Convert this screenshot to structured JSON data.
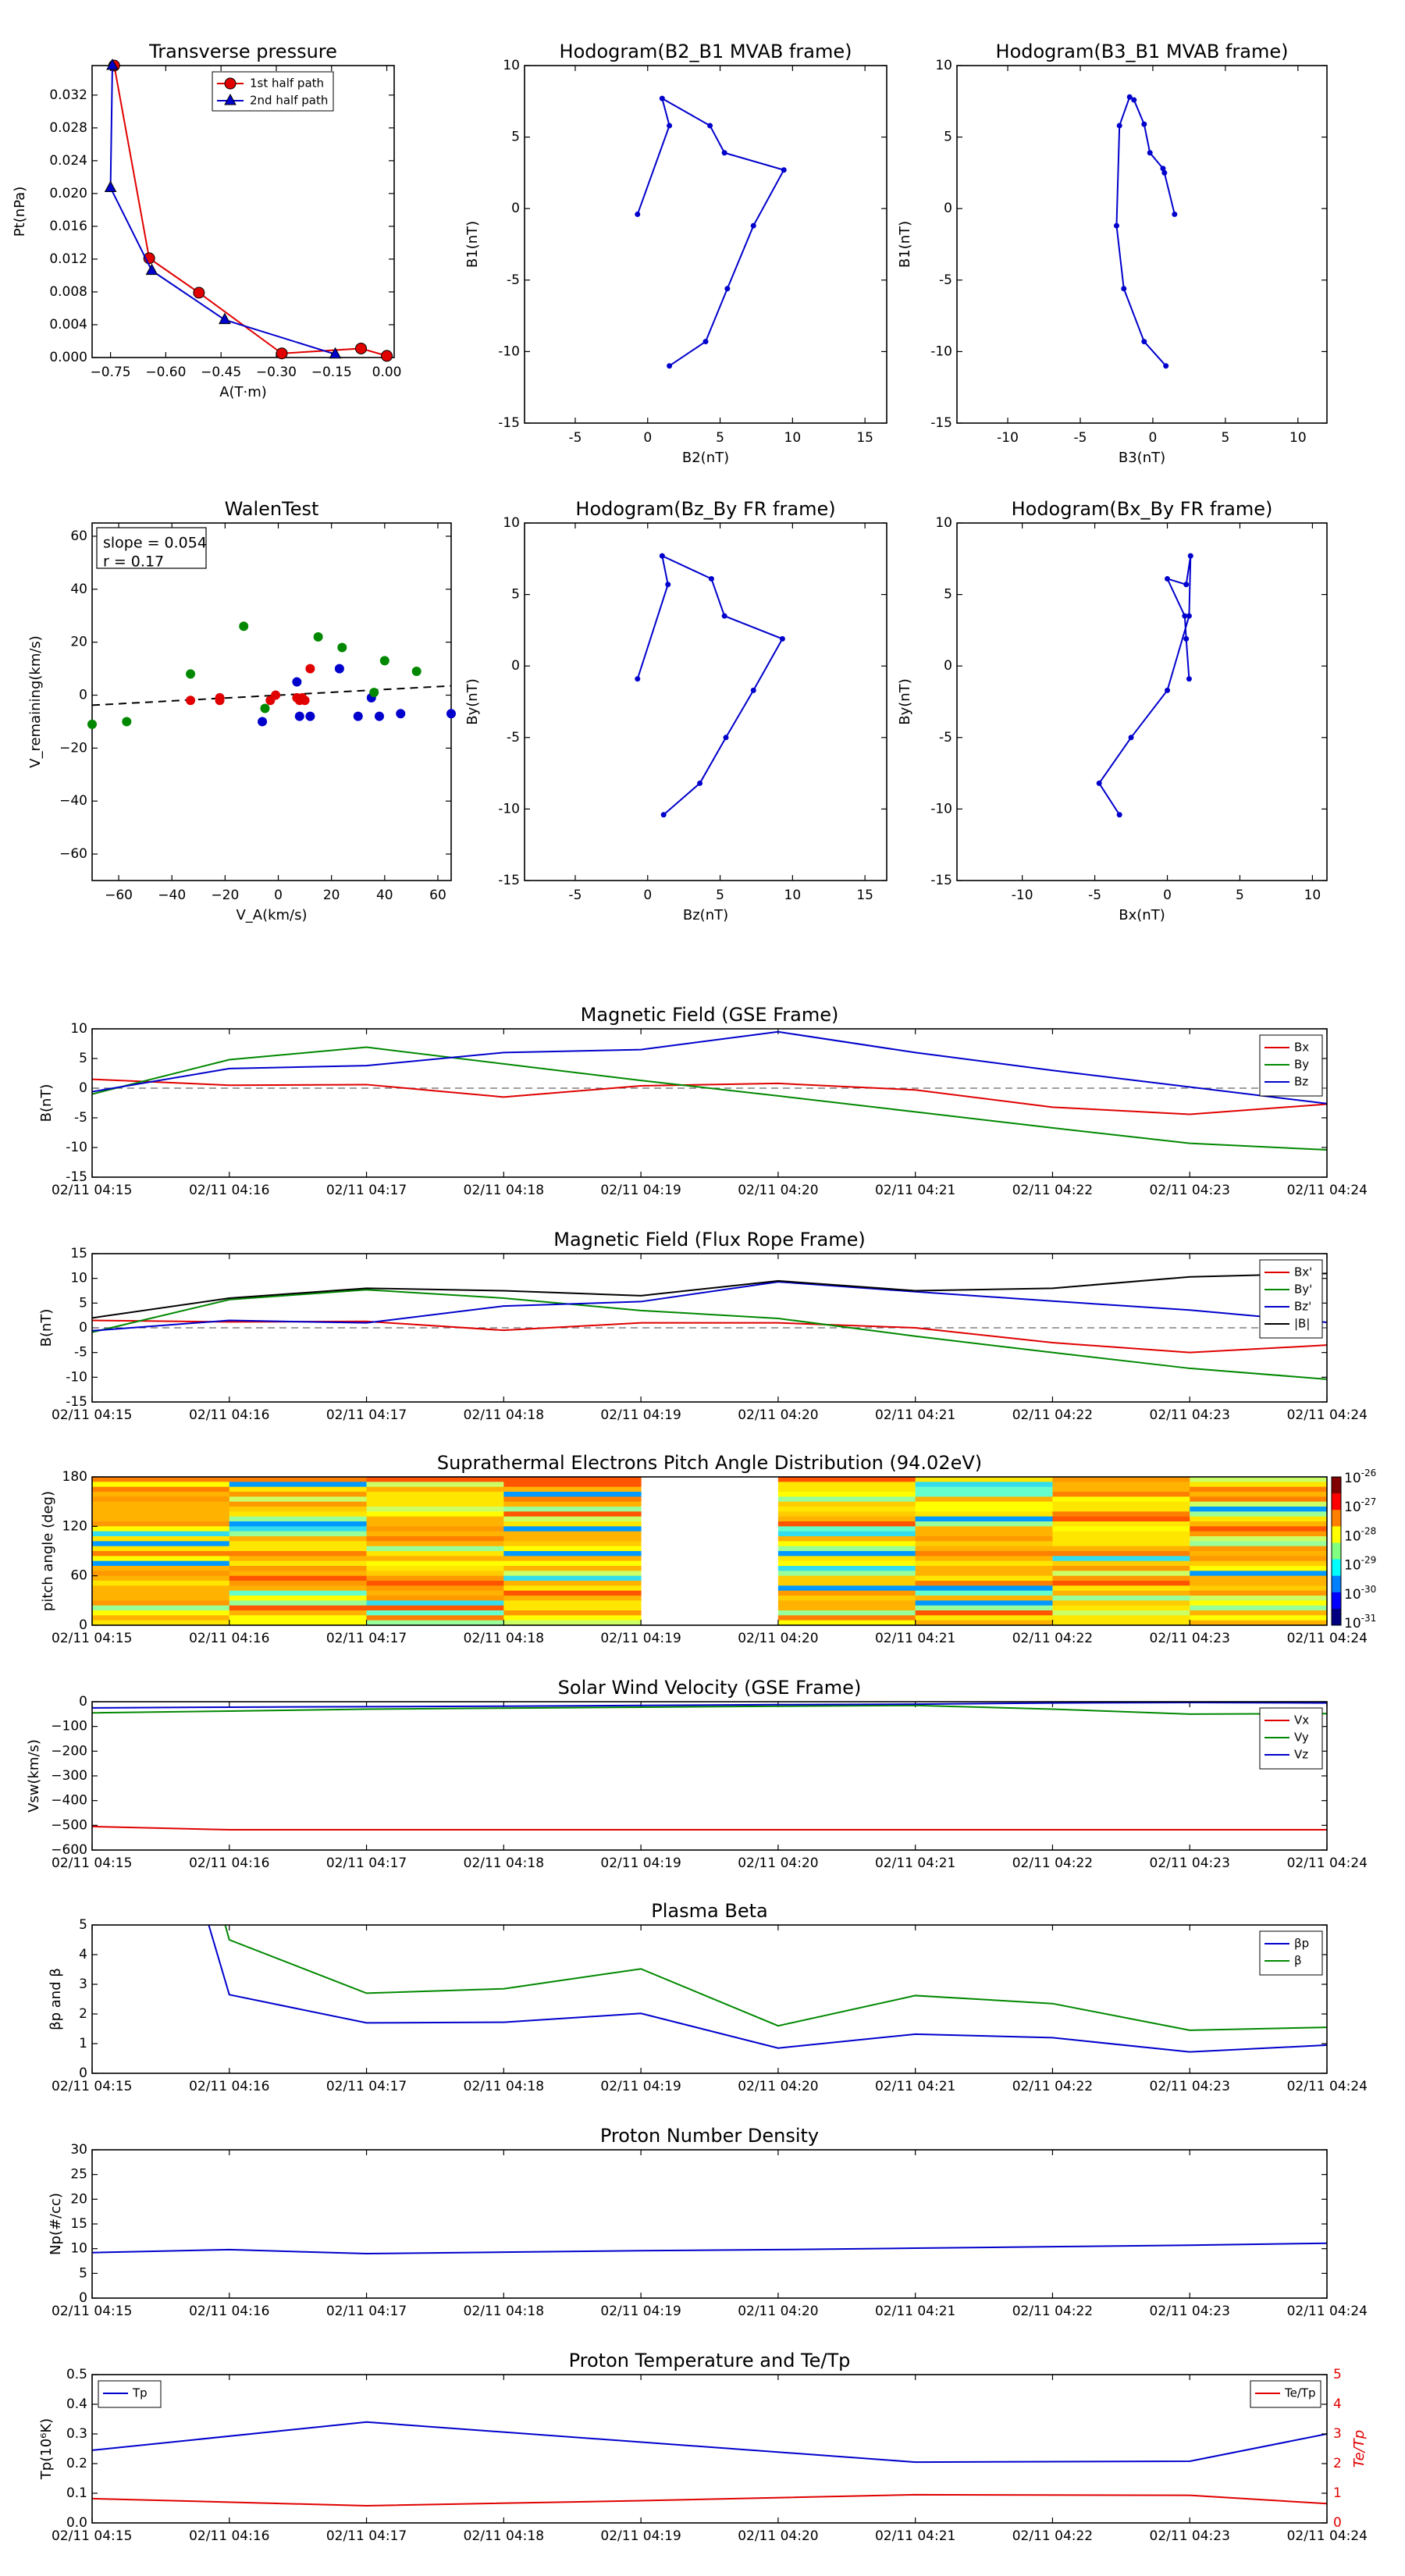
{
  "chart_data": [
    {
      "id": "pt",
      "type": "line",
      "title": "Transverse pressure",
      "xlabel": "A(T·m)",
      "ylabel": "Pt(nPa)",
      "xlim": [
        -0.8,
        0.02
      ],
      "ylim": [
        0,
        0.0356
      ],
      "xticks": [
        -0.75,
        -0.6,
        -0.45,
        -0.3,
        -0.15,
        0.0
      ],
      "xtick_labels": [
        "−0.75",
        "−0.60",
        "−0.45",
        "−0.30",
        "−0.15",
        "0.00"
      ],
      "yticks": [
        0,
        0.004,
        0.008,
        0.012,
        0.016,
        0.02,
        0.024,
        0.028,
        0.032
      ],
      "ytick_labels": [
        "0.000",
        "0.004",
        "0.008",
        "0.012",
        "0.016",
        "0.020",
        "0.024",
        "0.028",
        "0.032"
      ],
      "legend_pos": "upper-center",
      "series": [
        {
          "name": "1st half path",
          "color": "#e00000",
          "marker": "circle",
          "x": [
            -0.74,
            -0.645,
            -0.51,
            -0.285,
            -0.07,
            0.0
          ],
          "y": [
            0.0356,
            0.0121,
            0.0079,
            0.0005,
            0.0011,
            0.0002
          ]
        },
        {
          "name": "2nd half path",
          "color": "#0000cc",
          "marker": "triangle",
          "x": [
            -0.745,
            -0.75,
            -0.638,
            -0.44,
            -0.14
          ],
          "y": [
            0.0356,
            0.0207,
            0.0106,
            0.0046,
            0.0004
          ]
        }
      ]
    },
    {
      "id": "h1",
      "type": "line",
      "title": "Hodogram(B2_B1 MVAB frame)",
      "xlabel": "B2(nT)",
      "ylabel": "B1(nT)",
      "xlim": [
        -8.5,
        16.5
      ],
      "ylim": [
        -15,
        10
      ],
      "xticks": [
        -5,
        0,
        5,
        10,
        15
      ],
      "yticks": [
        -15,
        -10,
        -5,
        0,
        5,
        10
      ],
      "series": [
        {
          "color": "#0000cc",
          "marker": "dot",
          "x": [
            -0.7,
            1.5,
            1.0,
            4.3,
            5.3,
            9.4,
            7.3,
            5.5,
            4.0,
            1.5
          ],
          "y": [
            -0.4,
            5.8,
            7.7,
            5.8,
            3.9,
            2.7,
            -1.2,
            -5.6,
            -9.3,
            -11.0
          ]
        }
      ]
    },
    {
      "id": "h2",
      "type": "line",
      "title": "Hodogram(B3_B1 MVAB frame)",
      "xlabel": "B3(nT)",
      "ylabel": "B1(nT)",
      "xlim": [
        -13.5,
        12
      ],
      "ylim": [
        -15,
        10
      ],
      "xticks": [
        -10,
        -5,
        0,
        5,
        10
      ],
      "yticks": [
        -15,
        -10,
        -5,
        0,
        5,
        10
      ],
      "series": [
        {
          "color": "#0000cc",
          "marker": "dot",
          "x": [
            1.5,
            0.8,
            0.7,
            -0.2,
            -0.6,
            -1.3,
            -1.6,
            -2.3,
            -2.5,
            -2.0,
            -0.6,
            0.9
          ],
          "y": [
            -0.4,
            2.5,
            2.8,
            3.9,
            5.9,
            7.6,
            7.8,
            5.8,
            -1.2,
            -5.6,
            -9.3,
            -11.0
          ]
        }
      ]
    },
    {
      "id": "walen",
      "type": "scatter",
      "title": "WalenTest",
      "xlabel": "V_A(km/s)",
      "ylabel": "V_remaining(km/s)",
      "xlim": [
        -70,
        65
      ],
      "ylim": [
        -70,
        65
      ],
      "xticks": [
        -60,
        -40,
        -20,
        0,
        20,
        40,
        60
      ],
      "xtick_labels": [
        "−60",
        "−40",
        "−20",
        "0",
        "20",
        "40",
        "60"
      ],
      "yticks": [
        -60,
        -40,
        -20,
        0,
        20,
        40,
        60
      ],
      "ytick_labels": [
        "−60",
        "−40",
        "−20",
        "0",
        "20",
        "40",
        "60"
      ],
      "annotation": [
        "slope = 0.054",
        "r = 0.17"
      ],
      "fit_line": {
        "x": [
          -70,
          65
        ],
        "y": [
          -3.8,
          3.5
        ]
      },
      "series": [
        {
          "color": "#e00000",
          "x": [
            -33,
            -22,
            -22,
            -3,
            -1,
            7,
            8,
            9,
            10,
            12
          ],
          "y": [
            -2,
            -1,
            -2,
            -2,
            0,
            -1,
            -2,
            -1,
            -2,
            10
          ]
        },
        {
          "color": "#0000cc",
          "x": [
            7,
            8,
            12,
            23,
            30,
            35,
            38,
            46,
            65,
            -6
          ],
          "y": [
            5,
            -8,
            -8,
            10,
            -8,
            -1,
            -8,
            -7,
            -7,
            -10
          ]
        },
        {
          "color": "#008800",
          "x": [
            -70,
            -57,
            -33,
            -13,
            -5,
            15,
            24,
            36,
            40,
            52
          ],
          "y": [
            -11,
            -10,
            8,
            26,
            -5,
            22,
            18,
            1,
            13,
            9
          ]
        }
      ]
    },
    {
      "id": "h3",
      "type": "line",
      "title": "Hodogram(Bz_By FR frame)",
      "xlabel": "Bz(nT)",
      "ylabel": "By(nT)",
      "xlim": [
        -8.5,
        16.5
      ],
      "ylim": [
        -15,
        10
      ],
      "xticks": [
        -5,
        0,
        5,
        10,
        15
      ],
      "yticks": [
        -15,
        -10,
        -5,
        0,
        5,
        10
      ],
      "series": [
        {
          "color": "#0000cc",
          "marker": "dot",
          "x": [
            -0.7,
            1.4,
            1.0,
            4.4,
            5.3,
            9.3,
            7.3,
            5.4,
            3.6,
            1.1
          ],
          "y": [
            -0.9,
            5.7,
            7.7,
            6.1,
            3.5,
            1.9,
            -1.7,
            -5.0,
            -8.2,
            -10.4
          ]
        }
      ]
    },
    {
      "id": "h4",
      "type": "line",
      "title": "Hodogram(Bx_By FR frame)",
      "xlabel": "Bx(nT)",
      "ylabel": "By(nT)",
      "xlim": [
        -14.5,
        11
      ],
      "ylim": [
        -15,
        10
      ],
      "xticks": [
        -10,
        -5,
        0,
        5,
        10
      ],
      "yticks": [
        -15,
        -10,
        -5,
        0,
        5,
        10
      ],
      "series": [
        {
          "color": "#0000cc",
          "marker": "dot",
          "x": [
            1.5,
            1.3,
            1.2,
            0.0,
            1.3,
            1.6,
            1.5,
            0.0,
            -2.5,
            -4.7,
            -3.3
          ],
          "y": [
            -0.9,
            1.9,
            3.5,
            6.1,
            5.7,
            7.7,
            3.5,
            -1.7,
            -5.0,
            -8.2,
            -10.4
          ]
        }
      ]
    },
    {
      "id": "bgse",
      "type": "line",
      "title": "Magnetic Field (GSE Frame)",
      "ylabel": "B(nT)",
      "x": [
        0,
        1,
        2,
        3,
        4,
        5,
        6,
        7,
        8,
        9
      ],
      "xtick_labels": [
        "02/11 04:15",
        "02/11 04:16",
        "02/11 04:17",
        "02/11 04:18",
        "02/11 04:19",
        "02/11 04:20",
        "02/11 04:21",
        "02/11 04:22",
        "02/11 04:23",
        "02/11 04:24"
      ],
      "ylim": [
        -15,
        10
      ],
      "yticks": [
        -15,
        -10,
        -5,
        0,
        5,
        10
      ],
      "zero_line": true,
      "series": [
        {
          "name": "Bx",
          "color": "#e00000",
          "values": [
            1.5,
            0.5,
            0.6,
            -1.5,
            0.4,
            0.8,
            -0.3,
            -3.2,
            -4.4,
            -2.7
          ]
        },
        {
          "name": "By",
          "color": "#008800",
          "values": [
            -1.0,
            4.8,
            6.9,
            4.1,
            1.3,
            -1.3,
            -4.0,
            -6.7,
            -9.3,
            -10.4
          ]
        },
        {
          "name": "Bz",
          "color": "#0000cc",
          "values": [
            -0.6,
            3.3,
            3.8,
            6.0,
            6.5,
            9.5,
            6.0,
            3.0,
            0.2,
            -2.6
          ]
        }
      ]
    },
    {
      "id": "bfr",
      "type": "line",
      "title": "Magnetic Field (Flux Rope Frame)",
      "ylabel": "B(nT)",
      "x": [
        0,
        1,
        2,
        3,
        4,
        5,
        6,
        7,
        8,
        9
      ],
      "xtick_labels": [
        "02/11 04:15",
        "02/11 04:16",
        "02/11 04:17",
        "02/11 04:18",
        "02/11 04:19",
        "02/11 04:20",
        "02/11 04:21",
        "02/11 04:22",
        "02/11 04:23",
        "02/11 04:24"
      ],
      "ylim": [
        -15,
        15
      ],
      "yticks": [
        -15,
        -10,
        -5,
        0,
        5,
        10,
        15
      ],
      "zero_line": true,
      "series": [
        {
          "name": "Bx'",
          "color": "#e00000",
          "values": [
            1.5,
            1.2,
            1.3,
            -0.5,
            1.0,
            1.0,
            0.0,
            -3.0,
            -5.0,
            -3.5
          ]
        },
        {
          "name": "By'",
          "color": "#008800",
          "values": [
            -0.9,
            5.7,
            7.7,
            6.0,
            3.5,
            1.9,
            -1.7,
            -5.0,
            -8.2,
            -10.4
          ]
        },
        {
          "name": "Bz'",
          "color": "#0000cc",
          "values": [
            -0.6,
            1.5,
            1.0,
            4.4,
            5.3,
            9.3,
            7.3,
            5.4,
            3.6,
            1.1
          ]
        },
        {
          "name": "|B|",
          "color": "#000000",
          "values": [
            2.0,
            6.0,
            8.0,
            7.5,
            6.5,
            9.5,
            7.5,
            8.0,
            10.3,
            11.0
          ]
        }
      ]
    },
    {
      "id": "pad",
      "type": "heatmap",
      "title": "Suprathermal Electrons Pitch Angle Distribution (94.02eV)",
      "ylabel": "pitch angle (deg)",
      "xtick_labels": [
        "02/11 04:15",
        "02/11 04:16",
        "02/11 04:17",
        "02/11 04:18",
        "02/11 04:19",
        "02/11 04:20",
        "02/11 04:21",
        "02/11 04:22",
        "02/11 04:23",
        "02/11 04:24"
      ],
      "ylim": [
        0,
        180
      ],
      "yticks": [
        0,
        60,
        120,
        180
      ],
      "colorbar_labels": [
        "10",
        "10",
        "10",
        "10",
        "10",
        "10"
      ],
      "colorbar_exponents": [
        "-26",
        "-27",
        "-28",
        "-29",
        "-30",
        "-31"
      ],
      "empty_interval": [
        4,
        5
      ]
    },
    {
      "id": "vsw",
      "type": "line",
      "title": "Solar Wind Velocity (GSE Frame)",
      "ylabel": "Vsw(km/s)",
      "x": [
        0,
        1,
        2,
        3,
        4,
        5,
        6,
        7,
        8,
        9
      ],
      "xtick_labels": [
        "02/11 04:15",
        "02/11 04:16",
        "02/11 04:17",
        "02/11 04:18",
        "02/11 04:19",
        "02/11 04:20",
        "02/11 04:21",
        "02/11 04:22",
        "02/11 04:23",
        "02/11 04:24"
      ],
      "ylim": [
        -600,
        0
      ],
      "yticks": [
        -600,
        -500,
        -400,
        -300,
        -200,
        -100,
        0
      ],
      "ytick_labels": [
        "−600",
        "−500",
        "−400",
        "−300",
        "−200",
        "−100",
        "0"
      ],
      "series": [
        {
          "name": "Vx",
          "color": "#e00000",
          "values": [
            -505,
            -518,
            -518,
            -518,
            -518,
            -518,
            -518,
            -518,
            -518,
            -518
          ]
        },
        {
          "name": "Vy",
          "color": "#008800",
          "values": [
            -45,
            -38,
            -30,
            -26,
            -22,
            -18,
            -15,
            -30,
            -50,
            -48
          ]
        },
        {
          "name": "Vz",
          "color": "#0000cc",
          "values": [
            -25,
            -22,
            -20,
            -18,
            -15,
            -12,
            -10,
            -5,
            -3,
            -5
          ]
        }
      ]
    },
    {
      "id": "beta",
      "type": "line",
      "title": "Plasma Beta",
      "ylabel": "βp and β",
      "x": [
        0,
        1,
        2,
        3,
        4,
        5,
        6,
        7,
        8,
        9
      ],
      "xtick_labels": [
        "02/11 04:15",
        "02/11 04:16",
        "02/11 04:17",
        "02/11 04:18",
        "02/11 04:19",
        "02/11 04:20",
        "02/11 04:21",
        "02/11 04:22",
        "02/11 04:23",
        "02/11 04:24"
      ],
      "ylim": [
        0,
        5
      ],
      "yticks": [
        0,
        1,
        2,
        3,
        4,
        5
      ],
      "series": [
        {
          "name": "βp",
          "color": "#0000cc",
          "x": [
            0.85,
            1,
            2,
            3,
            4,
            5,
            6,
            7,
            8,
            9
          ],
          "values": [
            5.0,
            2.65,
            1.7,
            1.72,
            2.02,
            0.85,
            1.32,
            1.2,
            0.72,
            0.95
          ]
        },
        {
          "name": "β",
          "color": "#008800",
          "x": [
            0.97,
            1,
            2,
            3,
            4,
            5,
            6,
            7,
            8,
            9
          ],
          "values": [
            5.0,
            4.5,
            2.7,
            2.85,
            3.52,
            1.6,
            2.62,
            2.35,
            1.45,
            1.55
          ]
        }
      ]
    },
    {
      "id": "np",
      "type": "line",
      "title": "Proton Number Density",
      "ylabel": "Np(#/cc)",
      "x": [
        0,
        1,
        2,
        3,
        4,
        5,
        6,
        7,
        8,
        9
      ],
      "xtick_labels": [
        "02/11 04:15",
        "02/11 04:16",
        "02/11 04:17",
        "02/11 04:18",
        "02/11 04:19",
        "02/11 04:20",
        "02/11 04:21",
        "02/11 04:22",
        "02/11 04:23",
        "02/11 04:24"
      ],
      "ylim": [
        0,
        30
      ],
      "yticks": [
        0,
        5,
        10,
        15,
        20,
        25,
        30
      ],
      "series": [
        {
          "color": "#0000cc",
          "values": [
            9.2,
            9.8,
            9.0,
            9.3,
            9.6,
            9.8,
            10.1,
            10.4,
            10.7,
            11.1
          ]
        }
      ]
    },
    {
      "id": "tp",
      "type": "line",
      "title": "Proton Temperature and Te/Tp",
      "ylabel": "Tp(10⁶K)",
      "y2label": "Te/Tp",
      "x": [
        0,
        1,
        2,
        3,
        4,
        5,
        6,
        7,
        8,
        9
      ],
      "xtick_labels": [
        "02/11 04:15",
        "02/11 04:16",
        "02/11 04:17",
        "02/11 04:18",
        "02/11 04:19",
        "02/11 04:20",
        "02/11 04:21",
        "02/11 04:22",
        "02/11 04:23",
        "02/11 04:24"
      ],
      "ylim": [
        0,
        0.5
      ],
      "yticks": [
        0,
        0.1,
        0.2,
        0.3,
        0.4,
        0.5
      ],
      "ytick_labels": [
        "0.0",
        "0.1",
        "0.2",
        "0.3",
        "0.4",
        "0.5"
      ],
      "y2lim": [
        0,
        5
      ],
      "y2ticks": [
        0,
        1,
        2,
        3,
        4,
        5
      ],
      "series": [
        {
          "name": "Tp",
          "color": "#0000cc",
          "axis": "left",
          "x": [
            0,
            2,
            6,
            8,
            9
          ],
          "values": [
            0.245,
            0.34,
            0.205,
            0.208,
            0.3
          ]
        },
        {
          "name": "Te/Tp",
          "color": "#e00000",
          "axis": "right",
          "x": [
            0,
            2,
            4,
            6,
            8,
            9
          ],
          "values": [
            0.82,
            0.58,
            0.75,
            0.95,
            0.93,
            0.65
          ]
        }
      ]
    }
  ]
}
